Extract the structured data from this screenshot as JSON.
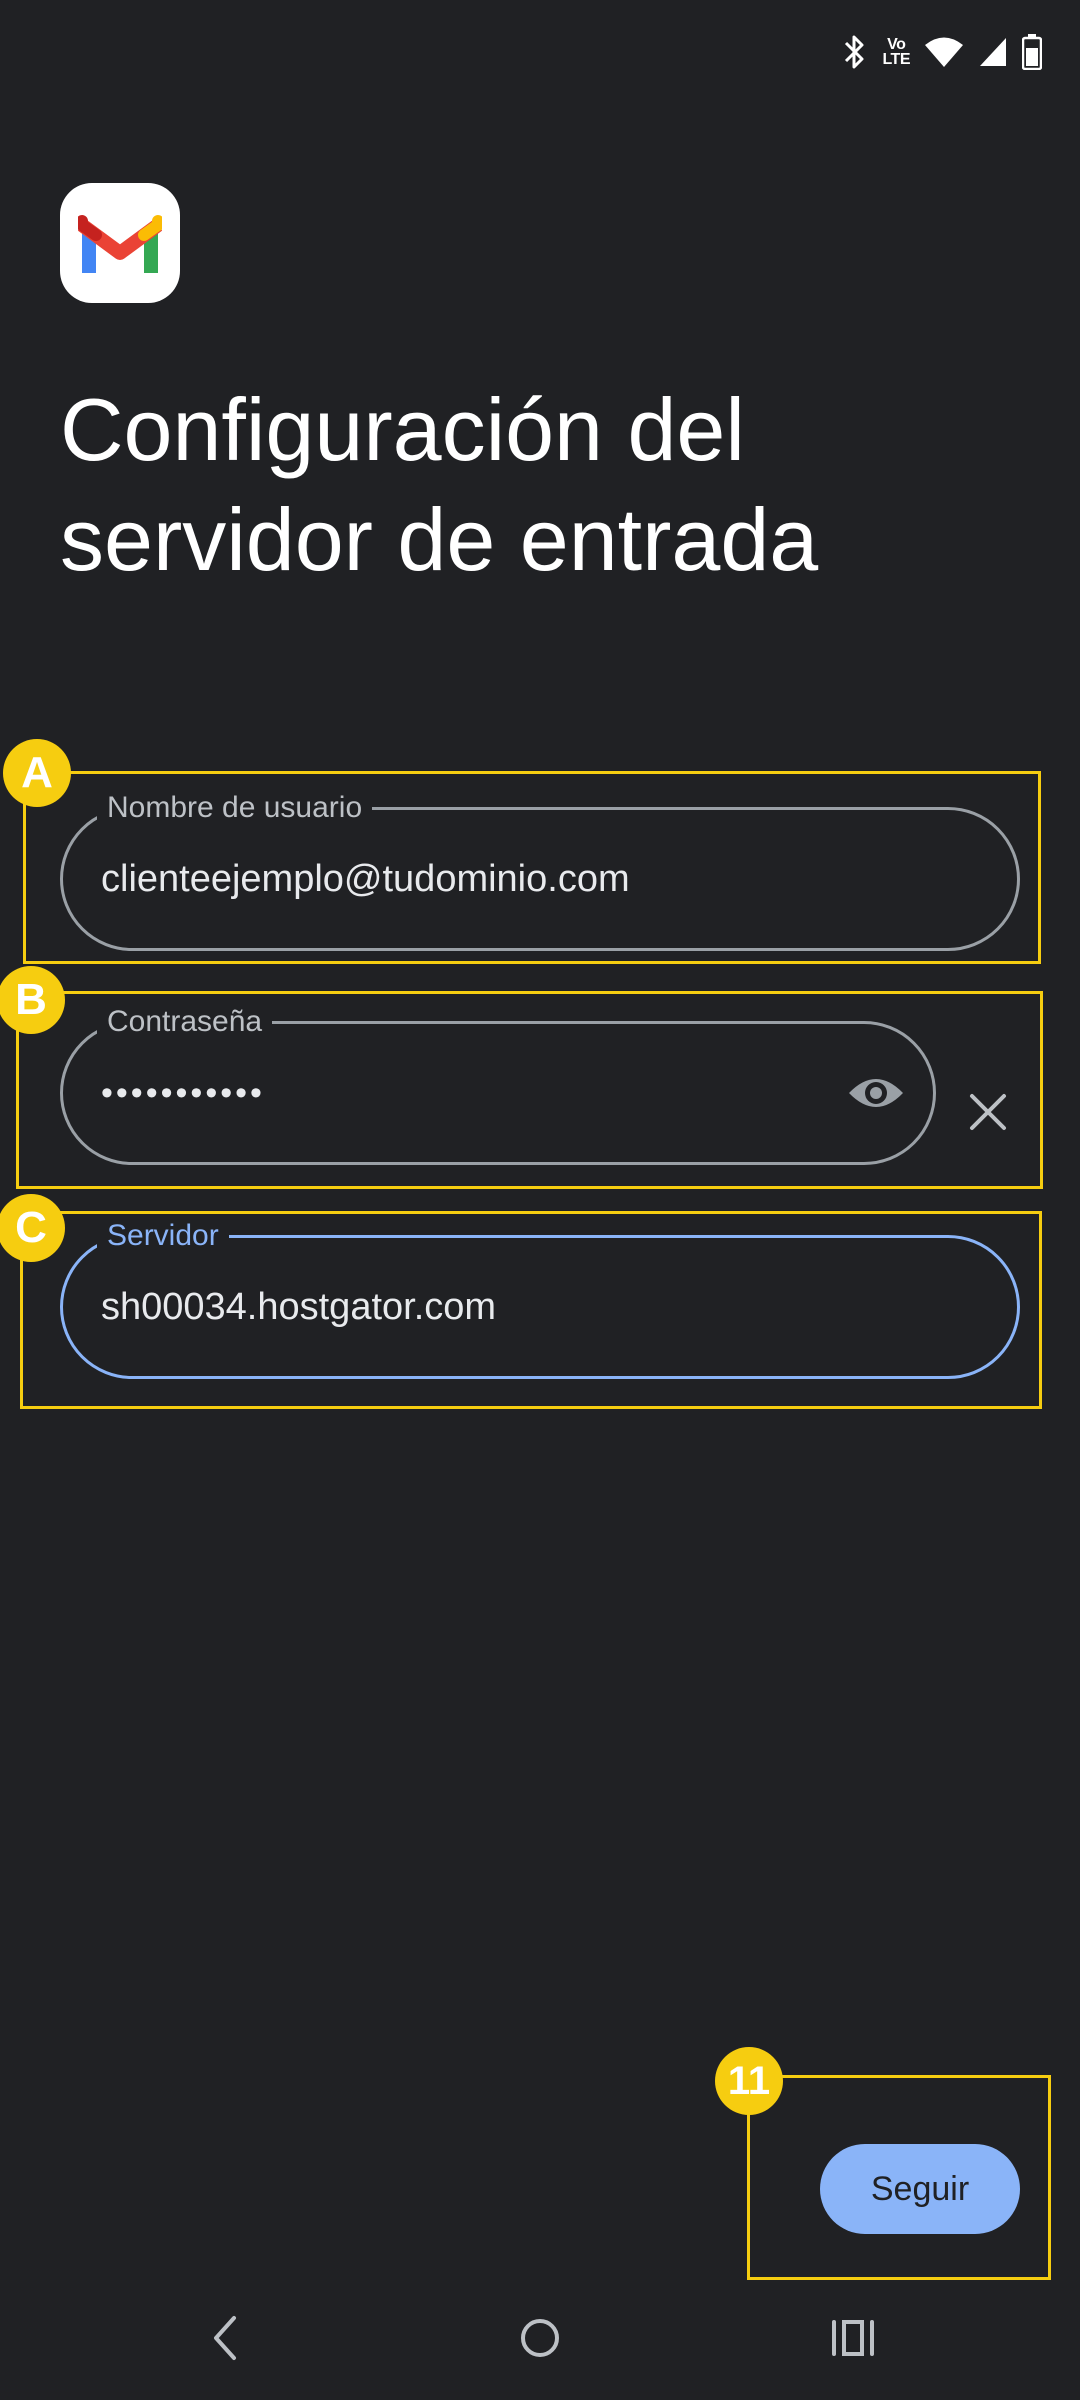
{
  "status_bar": {
    "icons": [
      "bluetooth-icon",
      "volte-icon",
      "wifi-icon",
      "signal-icon",
      "battery-icon"
    ],
    "volte_top": "Vo",
    "volte_bottom": "LTE"
  },
  "header": {
    "logo": "gmail-logo",
    "title_line1": "Configuración del",
    "title_line2": "servidor de entrada"
  },
  "form": {
    "username": {
      "label": "Nombre de usuario",
      "value": "clienteejemplo@tudominio.com"
    },
    "password": {
      "label": "Contraseña",
      "value": "•••••••••••"
    },
    "server": {
      "label": "Servidor",
      "value": "sh00034.hostgator.com"
    }
  },
  "annotations": {
    "a": "A",
    "b": "B",
    "c": "C",
    "step": "11"
  },
  "actions": {
    "next_label": "Seguir"
  },
  "nav_bar": {
    "buttons": [
      "back-icon",
      "home-icon",
      "recents-icon"
    ]
  },
  "colors": {
    "background": "#202124",
    "accent": "#8ab4f8",
    "annotation": "#f6cd10"
  }
}
